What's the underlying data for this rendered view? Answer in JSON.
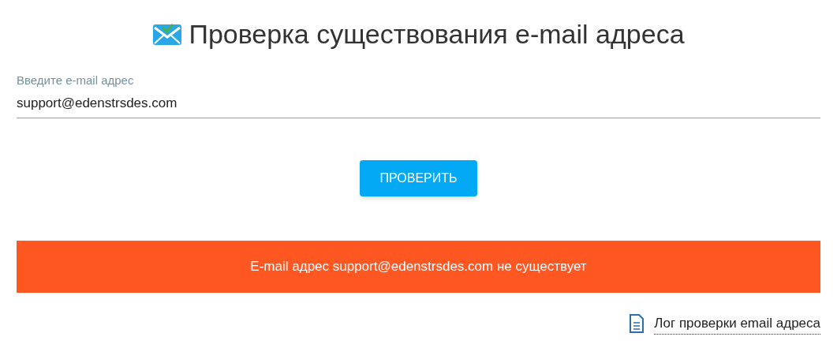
{
  "title": "Проверка существования e-mail адреса",
  "email_field": {
    "label": "Введите e-mail адрес",
    "value": "support@edenstrsdes.com"
  },
  "check_button": "ПРОВЕРИТЬ",
  "result": {
    "kind": "error",
    "message": "E-mail адрес support@edenstrsdes.com не существует"
  },
  "log_link": "Лог проверки email адреса"
}
